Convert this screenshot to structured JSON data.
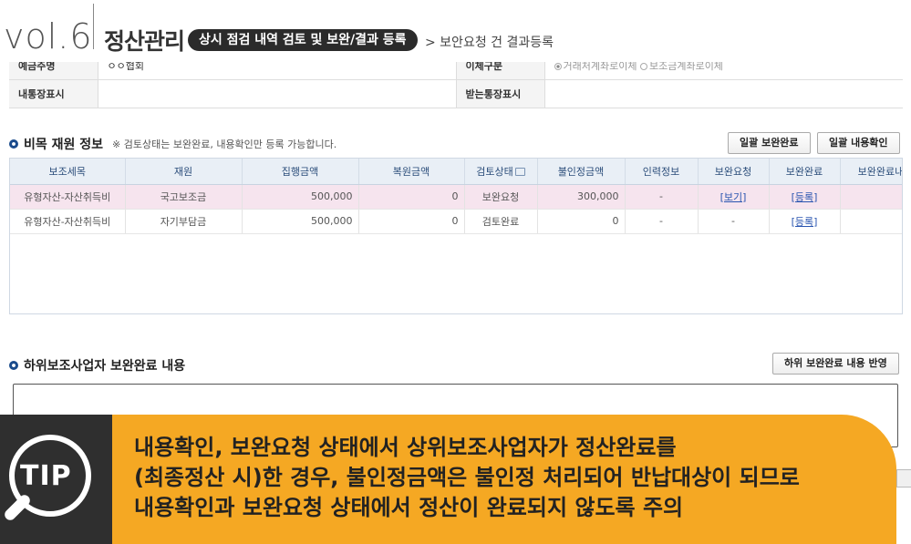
{
  "header": {
    "vol": "vol.6",
    "section": "정산관리",
    "crumb": "상시 점검 내역 검토 및 보완/결과 등록",
    "sub": "> 보안요청 건 결과등록"
  },
  "info": {
    "depositor_label": "예금주명",
    "depositor_value": "ㅇㅇ협회",
    "transfer_label": "이체구분",
    "transfer_opt1": "거래처계좌로이체",
    "transfer_opt2": "보조금계좌로이체",
    "my_memo_label": "내통장표시",
    "my_memo_value": "",
    "recv_memo_label": "받는통장표시",
    "recv_memo_value": ""
  },
  "items_section": {
    "title": "비목 재원 정보",
    "note": "※ 검토상태는 보완완료, 내용확인만 등록 가능합니다.",
    "btn_complete": "일괄 보완완료",
    "btn_confirm": "일괄 내용확인"
  },
  "grid": {
    "headers": [
      "보조세목",
      "재원",
      "집행금액",
      "복원금액",
      "검토상태",
      "불인정금액",
      "인력정보",
      "보완요청",
      "보완완료",
      "보완완료내용"
    ],
    "rows": [
      [
        "유형자산-자산취득비",
        "국고보조금",
        "500,000",
        "0",
        "보완요청",
        "300,000",
        "-",
        "[보기]",
        "[등록]",
        ""
      ],
      [
        "유형자산-자산취득비",
        "자기부담금",
        "500,000",
        "0",
        "검토완료",
        "0",
        "-",
        "-",
        "[등록]",
        ""
      ]
    ]
  },
  "sub_section": {
    "title": "하위보조사업자 보완완료 내용",
    "btn_apply": "하위 보완완료 내용 반영",
    "textarea_value": ""
  },
  "tip": {
    "label": "TIP",
    "line1": "내용확인, 보완요청 상태에서 상위보조사업자가 정산완료를",
    "line2": "(최종정산 시)한 경우, 불인정금액은 불인정 처리되어 반납대상이 되므로",
    "line3": "내용확인과 보완요청 상태에서 정산이 완료되지 않도록 주의"
  },
  "colors": {
    "accent": "#1a4b8c",
    "tip_orange": "#f5a823",
    "tip_dark": "#2f2f2f",
    "selected_row": "#f6e4ee"
  }
}
